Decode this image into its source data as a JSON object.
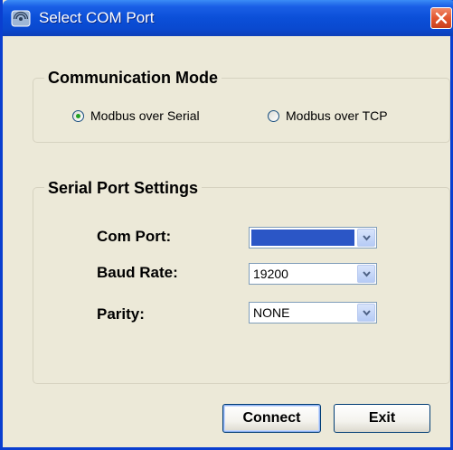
{
  "window": {
    "title": "Select COM Port",
    "title_icon": "app-icon",
    "close_icon": "close-icon"
  },
  "communication_mode": {
    "legend": "Communication Mode",
    "options": [
      {
        "label": "Modbus over Serial",
        "selected": true
      },
      {
        "label": "Modbus over TCP",
        "selected": false
      }
    ]
  },
  "serial_settings": {
    "legend": "Serial Port Settings",
    "com_port": {
      "label": "Com Port:",
      "value": ""
    },
    "baud_rate": {
      "label": "Baud Rate:",
      "value": "19200"
    },
    "parity": {
      "label": "Parity:",
      "value": "NONE"
    }
  },
  "buttons": {
    "connect": "Connect",
    "exit": "Exit"
  },
  "colors": {
    "titlebar": "#0b4fd8",
    "dialog_bg": "#ece9d8",
    "selection": "#2b56c6",
    "radio_dot": "#21a121"
  }
}
